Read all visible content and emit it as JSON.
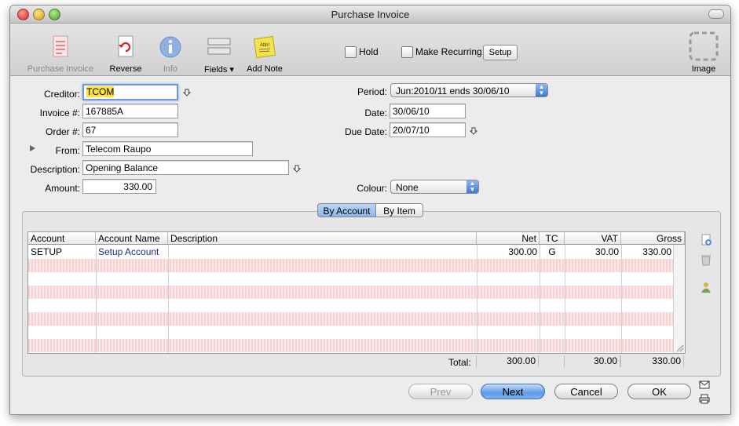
{
  "window": {
    "title": "Purchase Invoice"
  },
  "toolbar": {
    "purchase_invoice": "Purchase Invoice",
    "reverse": "Reverse",
    "info": "Info",
    "fields": "Fields",
    "add_note": "Add Note",
    "hold": "Hold",
    "make_recurring": "Make Recurring",
    "setup": "Setup",
    "image": "Image",
    "note_icon_text": "Attn!"
  },
  "form": {
    "creditor_label": "Creditor:",
    "creditor_value": "TCOM",
    "invoice_label": "Invoice #:",
    "invoice_value": "167885A",
    "order_label": "Order #:",
    "order_value": "67",
    "from_label": "From:",
    "from_value": "Telecom Raupo",
    "description_label": "Description:",
    "description_value": "Opening Balance",
    "amount_label": "Amount:",
    "amount_value": "330.00",
    "period_label": "Period:",
    "period_value": "Jun:2010/11 ends 30/06/10",
    "date_label": "Date:",
    "date_value": "30/06/10",
    "due_date_label": "Due Date:",
    "due_date_value": "20/07/10",
    "colour_label": "Colour:",
    "colour_value": "None"
  },
  "tabs": {
    "by_account": "By Account",
    "by_item": "By Item"
  },
  "table": {
    "headers": {
      "account": "Account",
      "account_name": "Account Name",
      "description": "Description",
      "net": "Net",
      "tc": "TC",
      "vat": "VAT",
      "gross": "Gross"
    },
    "rows": [
      {
        "account": "SETUP",
        "account_name": "Setup Account",
        "description": "",
        "net": "300.00",
        "tc": "G",
        "vat": "30.00",
        "gross": "330.00"
      }
    ],
    "totals": {
      "label": "Total:",
      "net": "300.00",
      "vat": "30.00",
      "gross": "330.00"
    }
  },
  "buttons": {
    "prev": "Prev",
    "next": "Next",
    "cancel": "Cancel",
    "ok": "OK"
  },
  "colors": {
    "highlight": "#ffe23a",
    "stripe": "#f6d3d3",
    "default_button": "#5d9be6"
  }
}
